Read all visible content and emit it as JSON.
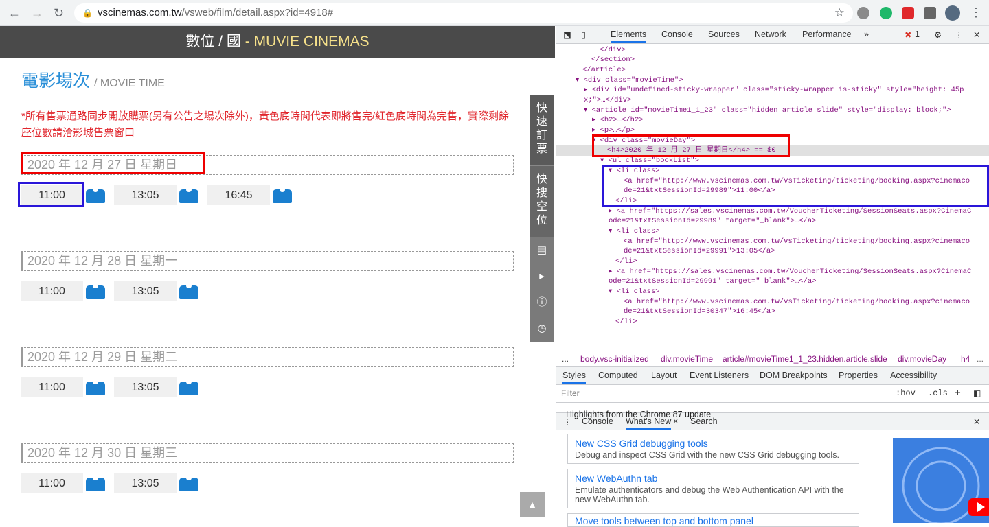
{
  "browser": {
    "url_host": "vscinemas.com.tw",
    "url_path": "/vsweb/film/detail.aspx?id=4918#"
  },
  "page": {
    "banner_prefix": "數位 / 國",
    "banner_suffix": "- MUVIE CINEMAS",
    "movie_time_title": "電影場次",
    "movie_time_sub": "/ MOVIE TIME",
    "notice": "*所有售票通路同步開放購票(另有公告之場次除外)，黃色底時間代表即將售完/紅色底時間為完售，實際剩餘座位數請洽影城售票窗口",
    "days": [
      {
        "date": "2020 年 12 月 27 日 星期日",
        "times": [
          "11:00",
          "13:05",
          "16:45"
        ]
      },
      {
        "date": "2020 年 12 月 28 日 星期一",
        "times": [
          "11:00",
          "13:05"
        ]
      },
      {
        "date": "2020 年 12 月 29 日 星期二",
        "times": [
          "11:00",
          "13:05"
        ]
      },
      {
        "date": "2020 年 12 月 30 日 星期三",
        "times": [
          "11:00",
          "13:05"
        ]
      }
    ],
    "sidebar_quick_book": "快速訂票",
    "sidebar_quick_search": "快搜空位"
  },
  "devtools": {
    "tabs": [
      "Elements",
      "Console",
      "Sources",
      "Network",
      "Performance",
      "»"
    ],
    "error_count": "1",
    "code_lines": [
      "</div>",
      "</section>",
      "</article>",
      "<div class=\"movieTime\">",
      "<div id=\"undefined-sticky-wrapper\" class=\"sticky-wrapper is-sticky\" style=\"height: 45p",
      "x;\">…</div>",
      "<article id=\"movieTime1_1_23\" class=\"hidden article slide\" style=\"display: block;\">",
      "<h2>…</h2>",
      "<p>…</p>",
      "<div class=\"movieDay\">",
      "<h4>2020 年 12 月 27 日 星期日</h4> == $0",
      "<ul class=\"bookList\">",
      "<li class>",
      "<a href=\"http://www.vscinemas.com.tw/vsTicketing/ticketing/booking.aspx?cinemaco",
      "de=21&txtSessionId=29989\">11:00</a>",
      "</li>",
      "<a href=\"https://sales.vscinemas.com.tw/VoucherTicketing/SessionSeats.aspx?CinemaC",
      "ode=21&txtSessionId=29989\" target=\"_blank\">…</a>",
      "<li class>",
      "<a href=\"http://www.vscinemas.com.tw/vsTicketing/ticketing/booking.aspx?cinemaco",
      "de=21&txtSessionId=29991\">13:05</a>",
      "</li>",
      "<a href=\"https://sales.vscinemas.com.tw/VoucherTicketing/SessionSeats.aspx?CinemaC",
      "ode=21&txtSessionId=29991\" target=\"_blank\">…</a>",
      "<li class>",
      "<a href=\"http://www.vscinemas.com.tw/vsTicketing/ticketing/booking.aspx?cinemaco",
      "de=21&txtSessionId=30347\">16:45</a>",
      "</li>"
    ],
    "breadcrumbs": [
      "...",
      "body.vsc-initialized",
      "div.movieTime",
      "article#movieTime1_1_23.hidden.article.slide",
      "div.movieDay",
      "h4",
      "..."
    ],
    "style_tabs": [
      "Styles",
      "Computed",
      "Layout",
      "Event Listeners",
      "DOM Breakpoints",
      "Properties",
      "Accessibility"
    ],
    "filter_placeholder": "Filter",
    "filter_hov": ":hov",
    "filter_cls": ".cls",
    "drawer_tabs": [
      "Console",
      "What's New",
      "Search"
    ],
    "highlights_title": "Highlights from the Chrome 87 update",
    "cards": [
      {
        "title": "New CSS Grid debugging tools",
        "desc": "Debug and inspect CSS Grid with the new CSS Grid debugging tools."
      },
      {
        "title": "New WebAuthn tab",
        "desc": "Emulate authenticators and debug the Web Authentication API with the new WebAuthn tab."
      },
      {
        "title": "Move tools between top and bottom panel",
        "desc": ""
      }
    ]
  },
  "colors": {
    "accent_blue": "#2a8fd8",
    "notice_red": "#e1262d",
    "ticket_blue": "#1a7fcf",
    "devtools_blue": "#1a73e8"
  }
}
